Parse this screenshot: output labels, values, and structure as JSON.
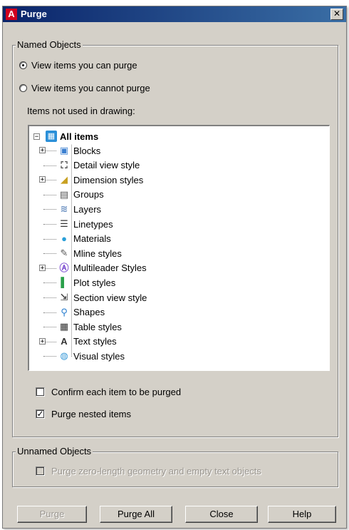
{
  "title": "Purge",
  "title_logo": "A",
  "close_glyph": "✕",
  "named_objects": {
    "legend": "Named Objects",
    "radio_can": {
      "label": "View items you can purge",
      "checked": true
    },
    "radio_cannot": {
      "label": "View items you cannot purge",
      "checked": false
    },
    "items_label": "Items not used in drawing:"
  },
  "tree": {
    "root": {
      "label": "All items",
      "icon": "all-items-icon",
      "expanded": true
    },
    "items": [
      {
        "label": "Blocks",
        "icon": "blocks-icon",
        "expandable": true
      },
      {
        "label": "Detail view style",
        "icon": "detail-view-style-icon",
        "expandable": false
      },
      {
        "label": "Dimension styles",
        "icon": "dimension-styles-icon",
        "expandable": true
      },
      {
        "label": "Groups",
        "icon": "groups-icon",
        "expandable": false
      },
      {
        "label": "Layers",
        "icon": "layers-icon",
        "expandable": false
      },
      {
        "label": "Linetypes",
        "icon": "linetypes-icon",
        "expandable": false
      },
      {
        "label": "Materials",
        "icon": "materials-icon",
        "expandable": false
      },
      {
        "label": "Mline styles",
        "icon": "mline-styles-icon",
        "expandable": false
      },
      {
        "label": "Multileader Styles",
        "icon": "multileader-styles-icon",
        "expandable": true
      },
      {
        "label": "Plot styles",
        "icon": "plot-styles-icon",
        "expandable": false
      },
      {
        "label": "Section view style",
        "icon": "section-view-style-icon",
        "expandable": false
      },
      {
        "label": "Shapes",
        "icon": "shapes-icon",
        "expandable": false
      },
      {
        "label": "Table styles",
        "icon": "table-styles-icon",
        "expandable": false
      },
      {
        "label": "Text styles",
        "icon": "text-styles-icon",
        "expandable": true
      },
      {
        "label": "Visual styles",
        "icon": "visual-styles-icon",
        "expandable": false
      }
    ]
  },
  "options": {
    "confirm": {
      "label": "Confirm each item to be purged",
      "checked": false
    },
    "nested": {
      "label": "Purge nested items",
      "checked": true
    }
  },
  "unnamed_objects": {
    "legend": "Unnamed Objects",
    "zero_length": {
      "label": "Purge zero-length geometry and empty text objects",
      "checked": false,
      "enabled": false
    }
  },
  "buttons": {
    "purge": {
      "label": "Purge",
      "enabled": false
    },
    "purge_all": {
      "label": "Purge All",
      "enabled": true
    },
    "close": {
      "label": "Close",
      "enabled": true
    },
    "help": {
      "label": "Help",
      "enabled": true
    }
  },
  "colors": {
    "dialog_bg": "#d4d0c8",
    "titlebar_start": "#0a246a",
    "titlebar_end": "#3a6ea5",
    "logo_red": "#d1001f",
    "disabled_text": "#9a9690"
  }
}
